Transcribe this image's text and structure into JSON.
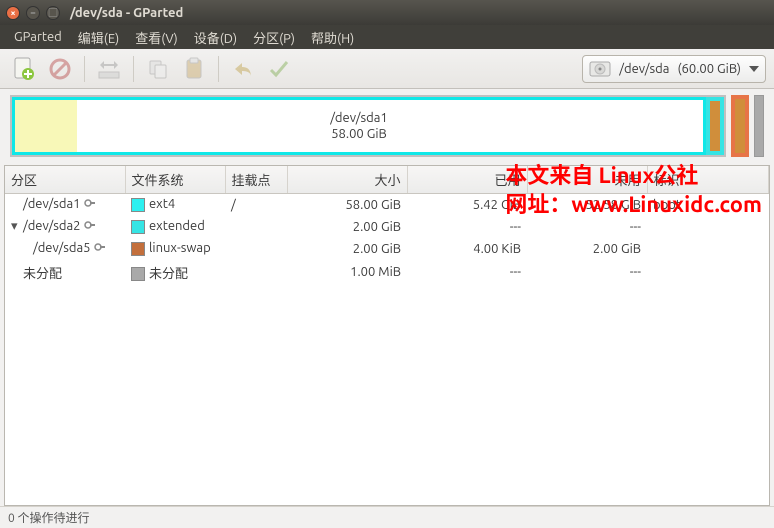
{
  "window": {
    "title": "/dev/sda - GParted"
  },
  "menu": {
    "gparted": "GParted",
    "edit": "编辑(E)",
    "view": "查看(V)",
    "device": "设备(D)",
    "partition": "分区(P)",
    "help": "帮助(H)"
  },
  "device_selector": {
    "device": "/dev/sda",
    "size": "(60.00 GiB)"
  },
  "graph": {
    "main_name": "/dev/sda1",
    "main_size": "58.00 GiB"
  },
  "cols": {
    "partition": "分区",
    "filesystem": "文件系统",
    "mount": "挂载点",
    "size": "大小",
    "used": "已用",
    "unused": "未用",
    "flags": "标识"
  },
  "rows": [
    {
      "name": "/dev/sda1",
      "lock": true,
      "expander": "",
      "color": "fs-ext4",
      "fs": "ext4",
      "mount": "/",
      "size": "58.00 GiB",
      "used": "5.42 GiB",
      "unused": "52.58 GiB",
      "flags": "boot",
      "indent": ""
    },
    {
      "name": "/dev/sda2",
      "lock": true,
      "expander": "▾",
      "color": "fs-extended",
      "fs": "extended",
      "mount": "",
      "size": "2.00 GiB",
      "used": "---",
      "unused": "---",
      "flags": "",
      "indent": ""
    },
    {
      "name": "/dev/sda5",
      "lock": true,
      "expander": "",
      "color": "fs-swap",
      "fs": "linux-swap",
      "mount": "",
      "size": "2.00 GiB",
      "used": "4.00 KiB",
      "unused": "2.00 GiB",
      "flags": "",
      "indent": "indent"
    },
    {
      "name": "未分配",
      "lock": false,
      "expander": "",
      "color": "fs-unalloc",
      "fs": "未分配",
      "mount": "",
      "size": "1.00 MiB",
      "used": "---",
      "unused": "---",
      "flags": "",
      "indent": ""
    }
  ],
  "status": "0 个操作待进行",
  "watermark": {
    "line1": "本文来自 Linux公社",
    "line2": "网址：www.Linuxidc.com"
  }
}
